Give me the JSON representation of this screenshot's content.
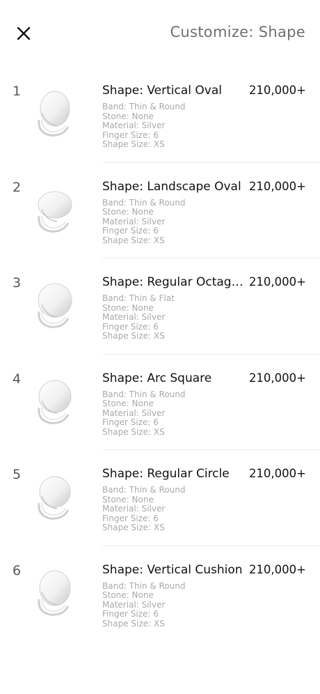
{
  "header": {
    "title": "Customize: Shape"
  },
  "labels": {
    "band": "Band: ",
    "stone": "Stone: ",
    "material": "Material: ",
    "finger_size": "Finger Size: ",
    "shape_size": "Shape Size: "
  },
  "items": [
    {
      "index": "1",
      "title": "Shape: Vertical Oval",
      "price": "210,000+",
      "band": "Thin & Round",
      "stone": "None",
      "material": "Silver",
      "finger_size": "6",
      "shape_size": "XS",
      "image": "ring-vertical-oval"
    },
    {
      "index": "2",
      "title": "Shape: Landscape Oval",
      "price": "210,000+",
      "band": "Thin & Round",
      "stone": "None",
      "material": "Silver",
      "finger_size": "6",
      "shape_size": "XS",
      "image": "ring-landscape-oval"
    },
    {
      "index": "3",
      "title": "Shape: Regular Octagon",
      "price": "210,000+",
      "band": "Thin & Flat",
      "stone": "None",
      "material": "Silver",
      "finger_size": "6",
      "shape_size": "XS",
      "image": "ring-regular-octagon"
    },
    {
      "index": "4",
      "title": "Shape: Arc Square",
      "price": "210,000+",
      "band": "Thin & Round",
      "stone": "None",
      "material": "Silver",
      "finger_size": "6",
      "shape_size": "XS",
      "image": "ring-arc-square"
    },
    {
      "index": "5",
      "title": "Shape: Regular Circle",
      "price": "210,000+",
      "band": "Thin & Round",
      "stone": "None",
      "material": "Silver",
      "finger_size": "6",
      "shape_size": "XS",
      "image": "ring-regular-circle"
    },
    {
      "index": "6",
      "title": "Shape: Vertical Cushion",
      "price": "210,000+",
      "band": "Thin & Round",
      "stone": "None",
      "material": "Silver",
      "finger_size": "6",
      "shape_size": "XS",
      "image": "ring-vertical-cushion"
    }
  ]
}
